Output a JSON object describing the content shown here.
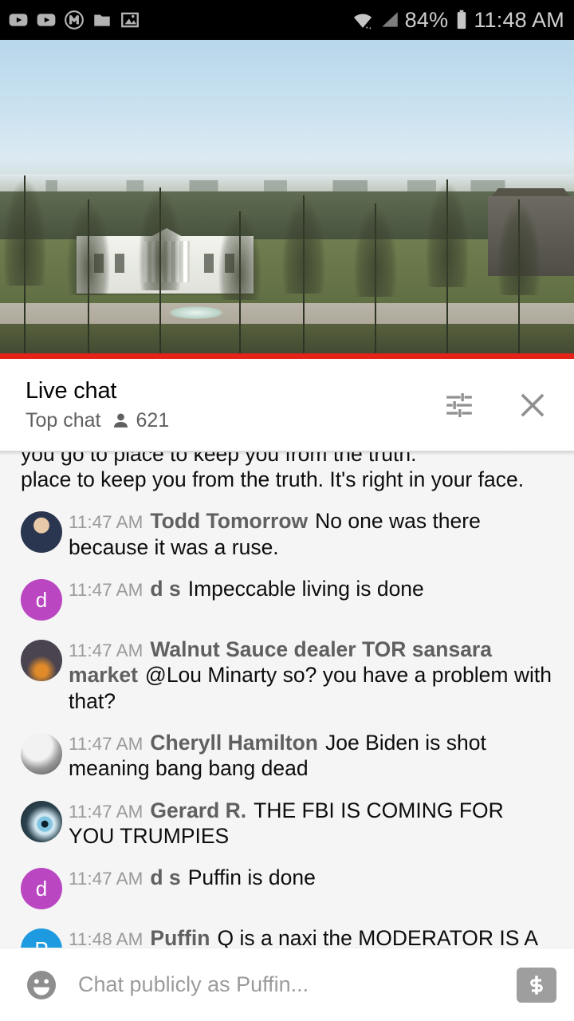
{
  "status_bar": {
    "icons": [
      "youtube-icon",
      "youtube-icon",
      "circle-m-icon",
      "folder-icon",
      "image-icon"
    ],
    "wifi_icon": "wifi-icon",
    "signal_icon": "signal-icon",
    "battery_percent": "84%",
    "battery_icon": "battery-icon",
    "clock": "11:48 AM"
  },
  "video": {
    "name": "white-house-live-stream",
    "progress_color": "#e62117",
    "progress_percent": 100
  },
  "chat_header": {
    "title": "Live chat",
    "mode": "Top chat",
    "viewer_icon": "person-icon",
    "viewer_count": "621",
    "settings_icon": "tune-icon",
    "close_icon": "close-icon"
  },
  "clipped_message": {
    "line1": "you go to place to keep you from the truth.",
    "visible_line": "place to keep you from the truth. It's right in your face."
  },
  "messages": [
    {
      "timestamp": "11:47 AM",
      "author": "Todd Tomorrow",
      "text": "No one was there because it was a ruse.",
      "avatar_type": "photo",
      "avatar_initial": "",
      "avatar_color": "#8a6a4a"
    },
    {
      "timestamp": "11:47 AM",
      "author": "d s",
      "text": "Impeccable living is done",
      "avatar_type": "initial",
      "avatar_initial": "d",
      "avatar_color": "#ba46c2"
    },
    {
      "timestamp": "11:47 AM",
      "author": "Walnut Sauce dealer TOR sansara market",
      "text": "@Lou Minarty so? you have a problem with that?",
      "avatar_type": "photo",
      "avatar_initial": "",
      "avatar_color": "#4c4a52"
    },
    {
      "timestamp": "11:47 AM",
      "author": "Cheryll Hamilton",
      "text": "Joe Biden is shot meaning bang bang dead",
      "avatar_type": "photo",
      "avatar_initial": "",
      "avatar_color": "#b8b8b8"
    },
    {
      "timestamp": "11:47 AM",
      "author": "Gerard R.",
      "text": "THE FBI IS COMING FOR YOU TRUMPIES",
      "avatar_type": "photo",
      "avatar_initial": "",
      "avatar_color": "#2d4650"
    },
    {
      "timestamp": "11:47 AM",
      "author": "d s",
      "text": "Puffin is done",
      "avatar_type": "initial",
      "avatar_initial": "d",
      "avatar_color": "#ba46c2"
    },
    {
      "timestamp": "11:48 AM",
      "author": "Puffin",
      "text": "Q is a naxi the MODERATOR IS A NAXI AND YOU ARE A NAZI",
      "avatar_type": "initial",
      "avatar_initial": "P",
      "avatar_color": "#1e9ae0"
    }
  ],
  "input_bar": {
    "emoji_icon": "emoji-smiley-icon",
    "placeholder": "Chat publicly as Puffin...",
    "value": "",
    "superchat_icon": "dollar-icon"
  }
}
